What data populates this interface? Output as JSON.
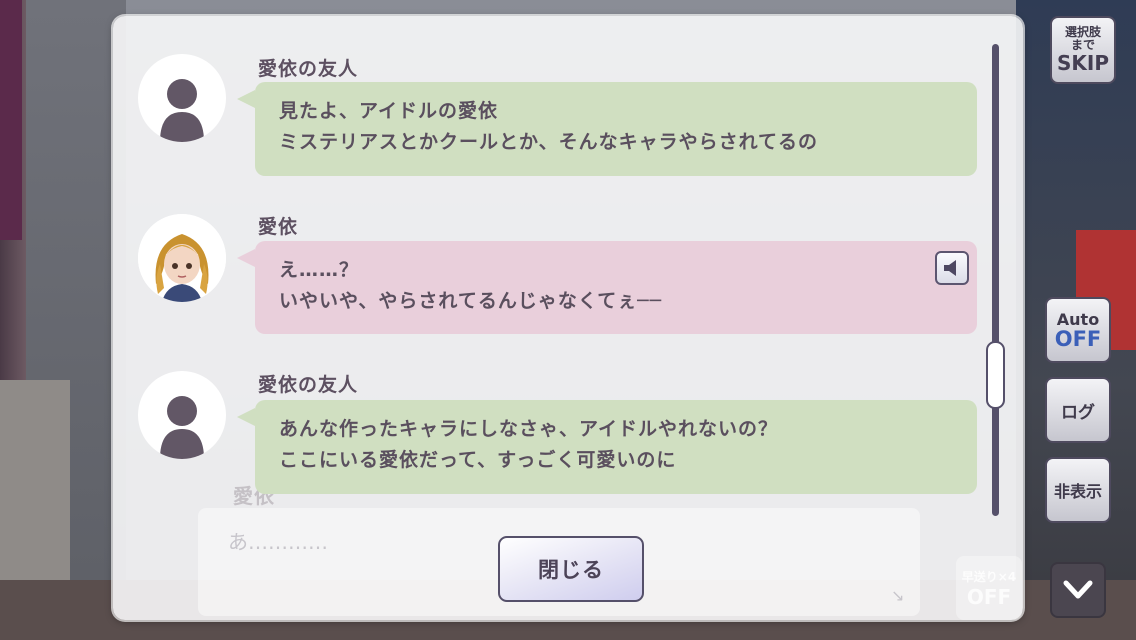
{
  "log": {
    "entries": [
      {
        "speaker": "愛依の友人",
        "lines": [
          "見たよ、アイドルの愛依",
          "ミステリアスとかクールとか、そんなキャラやらされてるの"
        ],
        "avatar": "silhouette-avatar",
        "bubble_color": "#d0dfc1"
      },
      {
        "speaker": "愛依",
        "lines": [
          "え……？",
          "いやいや、やらされてるんじゃなくてぇ──"
        ],
        "avatar": "character-portrait",
        "bubble_color": "#e9cfdb",
        "voice_icon": "speaker-icon"
      },
      {
        "speaker": "愛依の友人",
        "lines": [
          "あんな作ったキャラにしなさゃ、アイドルやれないの？",
          "ここにいる愛依だって、すっごく可愛いのに"
        ],
        "avatar": "silhouette-avatar",
        "bubble_color": "#d0dfc1"
      }
    ],
    "close_label": "閉じる"
  },
  "background_textbox": {
    "name": "愛依",
    "text": "あ…………",
    "arrow_icon": "diagonal-arrow-icon"
  },
  "controls": {
    "skip": {
      "line1": "選択肢",
      "line2": "まで",
      "line3": "SKIP"
    },
    "auto": {
      "label": "Auto",
      "state": "OFF"
    },
    "log": "ログ",
    "hide": "非表示",
    "down_icon": "chevron-down-icon",
    "speed": {
      "label": "早送り×4",
      "state": "OFF"
    }
  },
  "colors": {
    "accent_blue": "#3b5fb8",
    "border": "#55506a",
    "text": "#5a4f5e"
  }
}
